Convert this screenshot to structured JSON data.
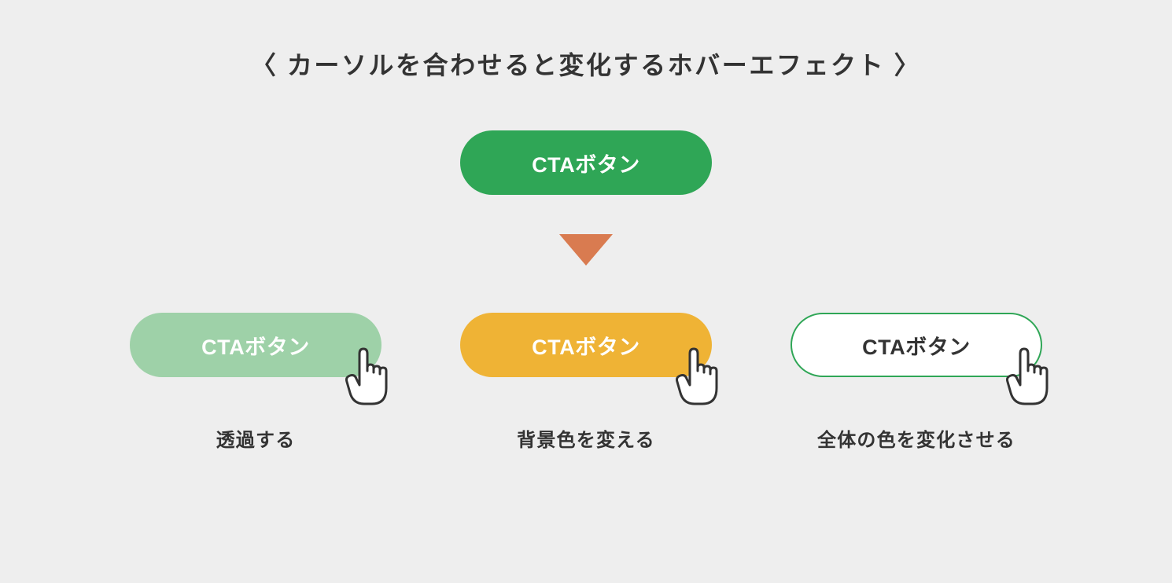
{
  "title": "〈 カーソルを合わせると変化するホバーエフェクト 〉",
  "main_button": {
    "label": "CTAボタン"
  },
  "variants": [
    {
      "label": "CTAボタン",
      "caption": "透過する"
    },
    {
      "label": "CTAボタン",
      "caption": "背景色を変える"
    },
    {
      "label": "CTAボタン",
      "caption": "全体の色を変化させる"
    }
  ],
  "colors": {
    "background": "#eeeeee",
    "green": "#2fa656",
    "green_light": "#9ed1a8",
    "orange": "#efb335",
    "white": "#ffffff",
    "arrow": "#d97b50",
    "text": "#333333"
  }
}
